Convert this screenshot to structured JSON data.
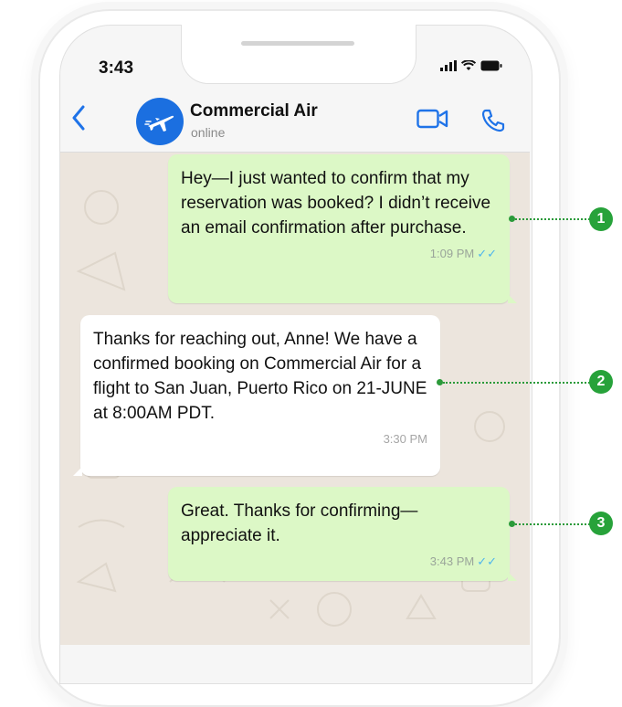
{
  "status_bar": {
    "time": "3:43"
  },
  "header": {
    "contact_name": "Commercial Air",
    "contact_status": "online",
    "icons": {
      "back": "chevron-left-icon",
      "avatar": "airplane-icon",
      "video": "video-camera-icon",
      "call": "phone-icon"
    }
  },
  "messages": [
    {
      "direction": "outgoing",
      "text": "Hey—I just wanted to confirm that my reservation was booked? I didn’t receive an email confirmation after purchase.",
      "time": "1:09 PM",
      "read_ticks": "✓✓"
    },
    {
      "direction": "incoming",
      "text": "Thanks for reaching out, Anne! We have a confirmed booking on Commercial Air for a flight to San Juan, Puerto Rico on 21-JUNE at 8:00AM PDT.",
      "time": "3:30 PM"
    },
    {
      "direction": "outgoing",
      "text": "Great. Thanks for confirming—appreciate it.",
      "time": "3:43 PM",
      "read_ticks": "✓✓"
    }
  ],
  "callouts": [
    "1",
    "2",
    "3"
  ],
  "colors": {
    "outgoing_bubble": "#dcf8c6",
    "incoming_bubble": "#ffffff",
    "wallpaper": "#ece5dd",
    "accent_blue": "#1b6fe0",
    "callout_green": "#27a23a",
    "read_ticks": "#4fb6ec"
  }
}
